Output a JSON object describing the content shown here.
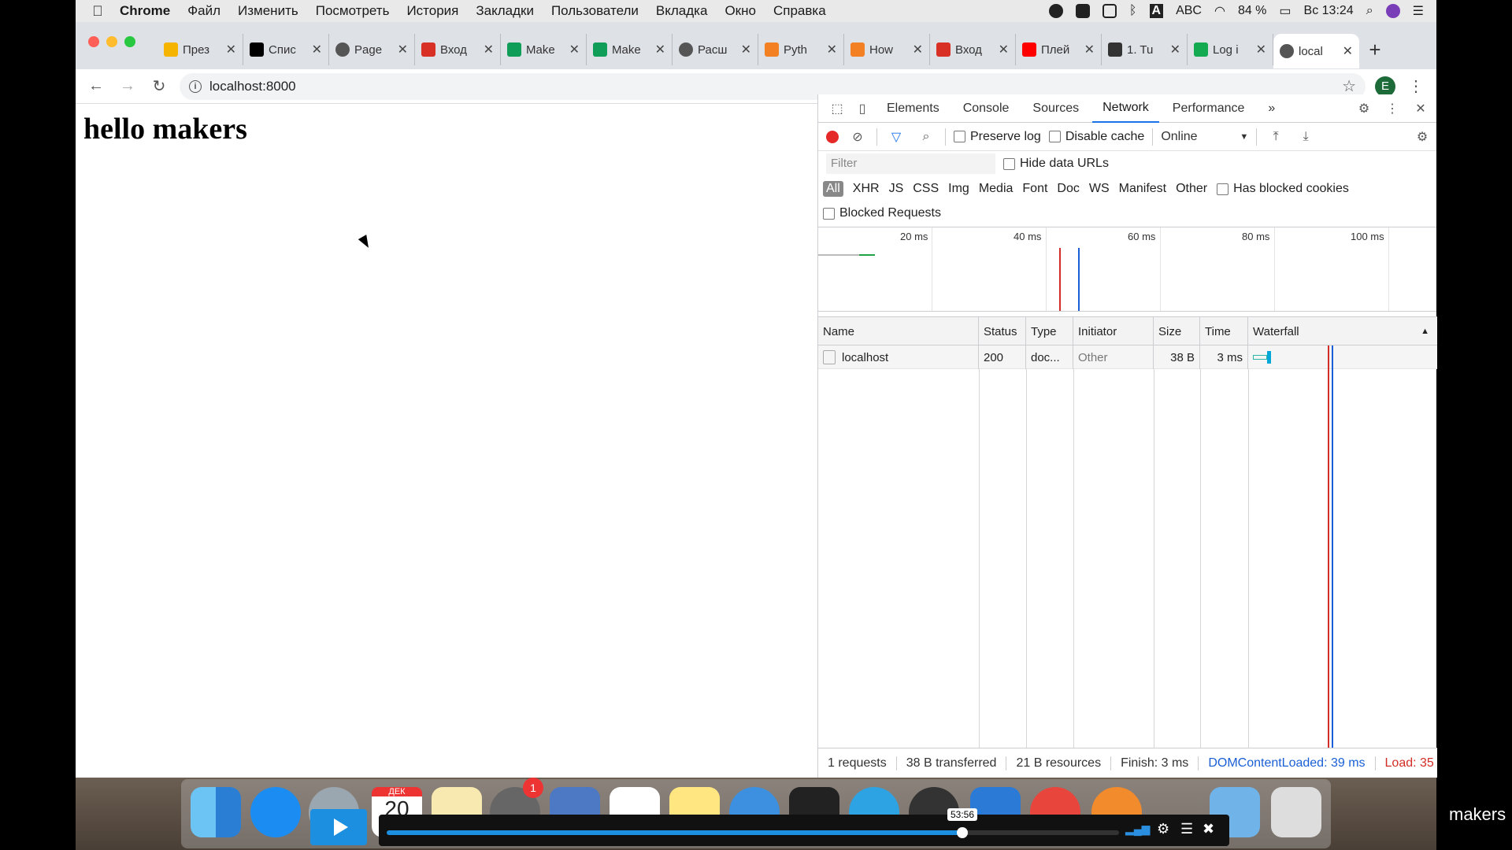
{
  "menubar": {
    "app": "Chrome",
    "items": [
      "Файл",
      "Изменить",
      "Посмотреть",
      "История",
      "Закладки",
      "Пользователи",
      "Вкладка",
      "Окно",
      "Справка"
    ],
    "status": {
      "lang": "ABC",
      "battery": "84 %",
      "clock": "Вс 13:24"
    }
  },
  "tabs": [
    {
      "title": "През",
      "icon": "slides-icon",
      "color": "#f4b400"
    },
    {
      "title": "Спис",
      "icon": "wikipedia-icon",
      "color": "#000"
    },
    {
      "title": "Page",
      "icon": "globe-icon",
      "color": "#555"
    },
    {
      "title": "Вход",
      "icon": "gmail-icon",
      "color": "#d93025"
    },
    {
      "title": "Make",
      "icon": "sheets-icon",
      "color": "#0f9d58"
    },
    {
      "title": "Make",
      "icon": "sheets-icon",
      "color": "#0f9d58"
    },
    {
      "title": "Расш",
      "icon": "globe-icon",
      "color": "#555"
    },
    {
      "title": "Pyth",
      "icon": "stackoverflow-icon",
      "color": "#f48024"
    },
    {
      "title": "How",
      "icon": "stackoverflow-icon",
      "color": "#f48024"
    },
    {
      "title": "Вход",
      "icon": "gmail-icon",
      "color": "#d93025"
    },
    {
      "title": "Плей",
      "icon": "youtube-icon",
      "color": "#ff0000"
    },
    {
      "title": "1. Tu",
      "icon": "book-icon",
      "color": "#333"
    },
    {
      "title": "Log i",
      "icon": "mongodb-icon",
      "color": "#13aa52"
    },
    {
      "title": "local",
      "icon": "globe-icon",
      "color": "#555",
      "active": true
    }
  ],
  "omnibox": {
    "url": "localhost:8000"
  },
  "profile": {
    "initial": "E"
  },
  "page": {
    "heading": "hello makers"
  },
  "devtools": {
    "tabs": [
      "Elements",
      "Console",
      "Sources",
      "Network",
      "Performance"
    ],
    "active_tab": "Network",
    "more": "»",
    "toolbar": {
      "preserve_log": "Preserve log",
      "disable_cache": "Disable cache",
      "throttle": "Online"
    },
    "filter": {
      "placeholder": "Filter",
      "hide_data_urls": "Hide data URLs"
    },
    "types": [
      "All",
      "XHR",
      "JS",
      "CSS",
      "Img",
      "Media",
      "Font",
      "Doc",
      "WS",
      "Manifest",
      "Other"
    ],
    "has_blocked_cookies": "Has blocked cookies",
    "blocked_requests": "Blocked Requests",
    "timeline_ticks": [
      "20 ms",
      "40 ms",
      "60 ms",
      "80 ms",
      "100 ms"
    ],
    "columns": [
      "Name",
      "Status",
      "Type",
      "Initiator",
      "Size",
      "Time",
      "Waterfall"
    ],
    "rows": [
      {
        "name": "localhost",
        "status": "200",
        "type": "doc...",
        "initiator": "Other",
        "size": "38 B",
        "time": "3 ms"
      }
    ],
    "status": {
      "requests": "1 requests",
      "transferred": "38 B transferred",
      "resources": "21 B resources",
      "finish": "Finish: 3 ms",
      "dcl": "DOMContentLoaded: 39 ms",
      "load": "Load: 35"
    },
    "colors": {
      "dcl": "#1a5fd6",
      "load": "#d32d27"
    }
  },
  "dock": {
    "player_time": "53:56",
    "badge": "1",
    "calendar_month": "ДЕК",
    "calendar_day": "20"
  },
  "watermark": "makers"
}
